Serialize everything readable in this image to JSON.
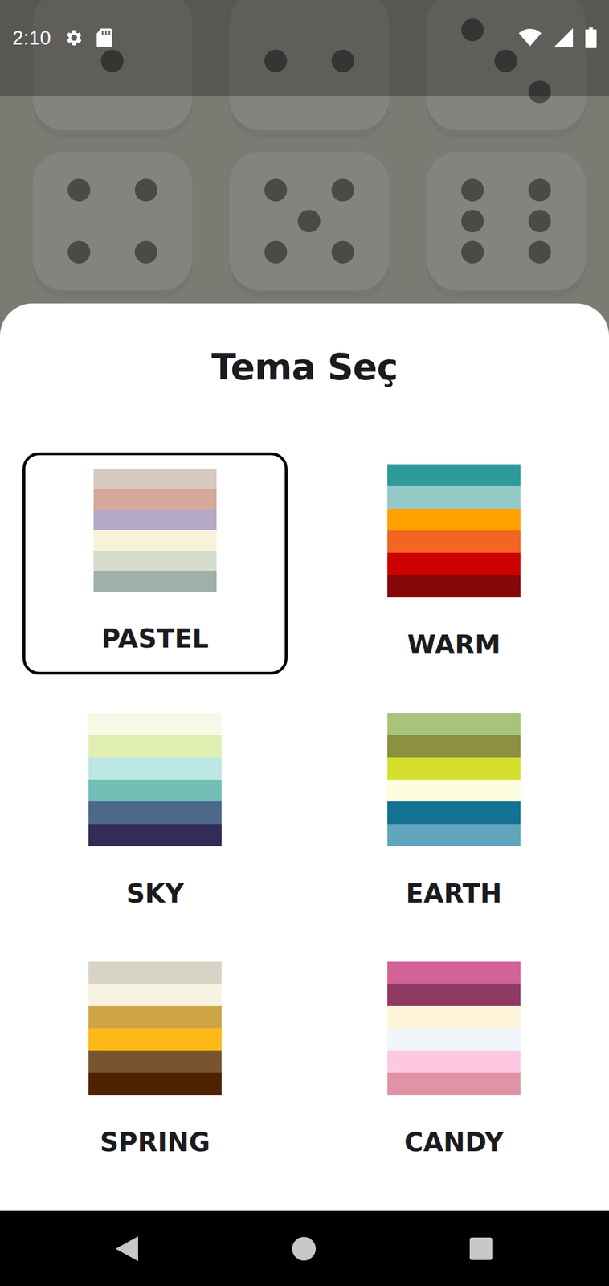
{
  "status_bar": {
    "time": "2:10"
  },
  "background_dice": [
    {
      "value": 1
    },
    {
      "value": 2
    },
    {
      "value": 3
    },
    {
      "value": 4
    },
    {
      "value": 5
    },
    {
      "value": 6
    }
  ],
  "sheet": {
    "title": "Tema Seç"
  },
  "themes": [
    {
      "name": "PASTEL",
      "selected": true,
      "colors": [
        "#d8c9c1",
        "#d6a89b",
        "#b3a9c4",
        "#f8f2da",
        "#d6dccb",
        "#9fb0aa"
      ]
    },
    {
      "name": "WARM",
      "selected": false,
      "colors": [
        "#2e9a9a",
        "#95c9c8",
        "#ff9f00",
        "#f46423",
        "#cc0000",
        "#850707"
      ]
    },
    {
      "name": "SKY",
      "selected": false,
      "colors": [
        "#f5fae6",
        "#e1eeb2",
        "#bde7e2",
        "#72bfb8",
        "#4e6889",
        "#332c57"
      ]
    },
    {
      "name": "EARTH",
      "selected": false,
      "colors": [
        "#a7c47a",
        "#8b913f",
        "#d4e02d",
        "#fdfde0",
        "#147292",
        "#61a5bf"
      ]
    },
    {
      "name": "SPRING",
      "selected": false,
      "colors": [
        "#d8d4c5",
        "#f7f2e1",
        "#cda545",
        "#fcb918",
        "#785530",
        "#4e2200"
      ]
    },
    {
      "name": "CANDY",
      "selected": false,
      "colors": [
        "#d26399",
        "#8f3a62",
        "#fef5da",
        "#f0f6f9",
        "#fec9e0",
        "#e093a6"
      ]
    }
  ]
}
